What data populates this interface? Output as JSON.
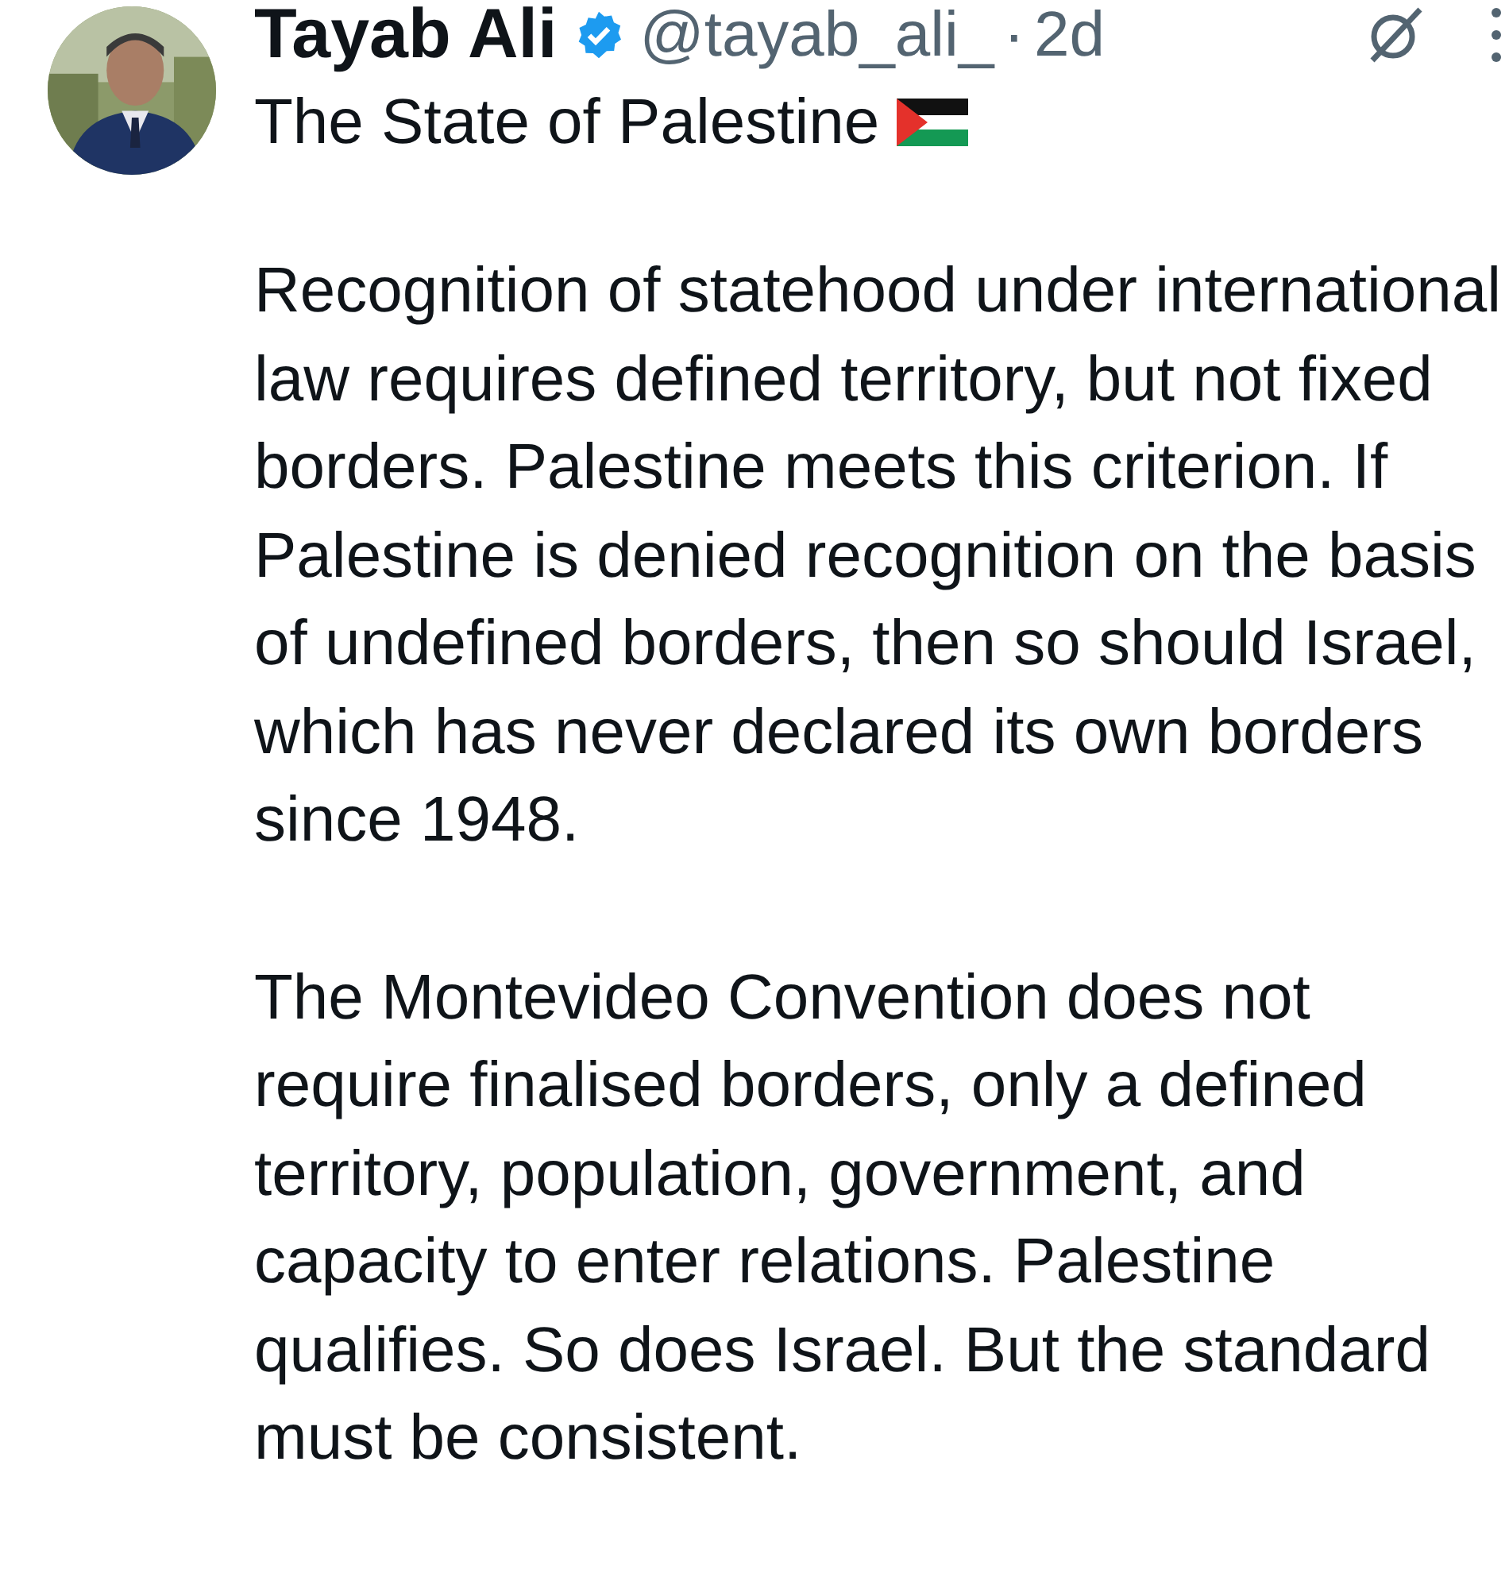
{
  "post": {
    "author": {
      "name": "Tayab Ali",
      "verified": true,
      "handle": "@tayab_ali_",
      "separator": "·",
      "time": "2d"
    },
    "title": "The State of Palestine",
    "paragraphs": [
      "Recognition of statehood under international law requires defined territory, but not fixed borders. Palestine meets this criterion. If Palestine is denied recognition on the basis of undefined borders, then so should Israel, which has never declared its own borders since 1948.",
      "The Montevideo Convention does not require finalised borders, only a defined territory, population, government, and capacity to enter relations. Palestine qualifies. So does Israel. But the standard must be consistent."
    ]
  }
}
